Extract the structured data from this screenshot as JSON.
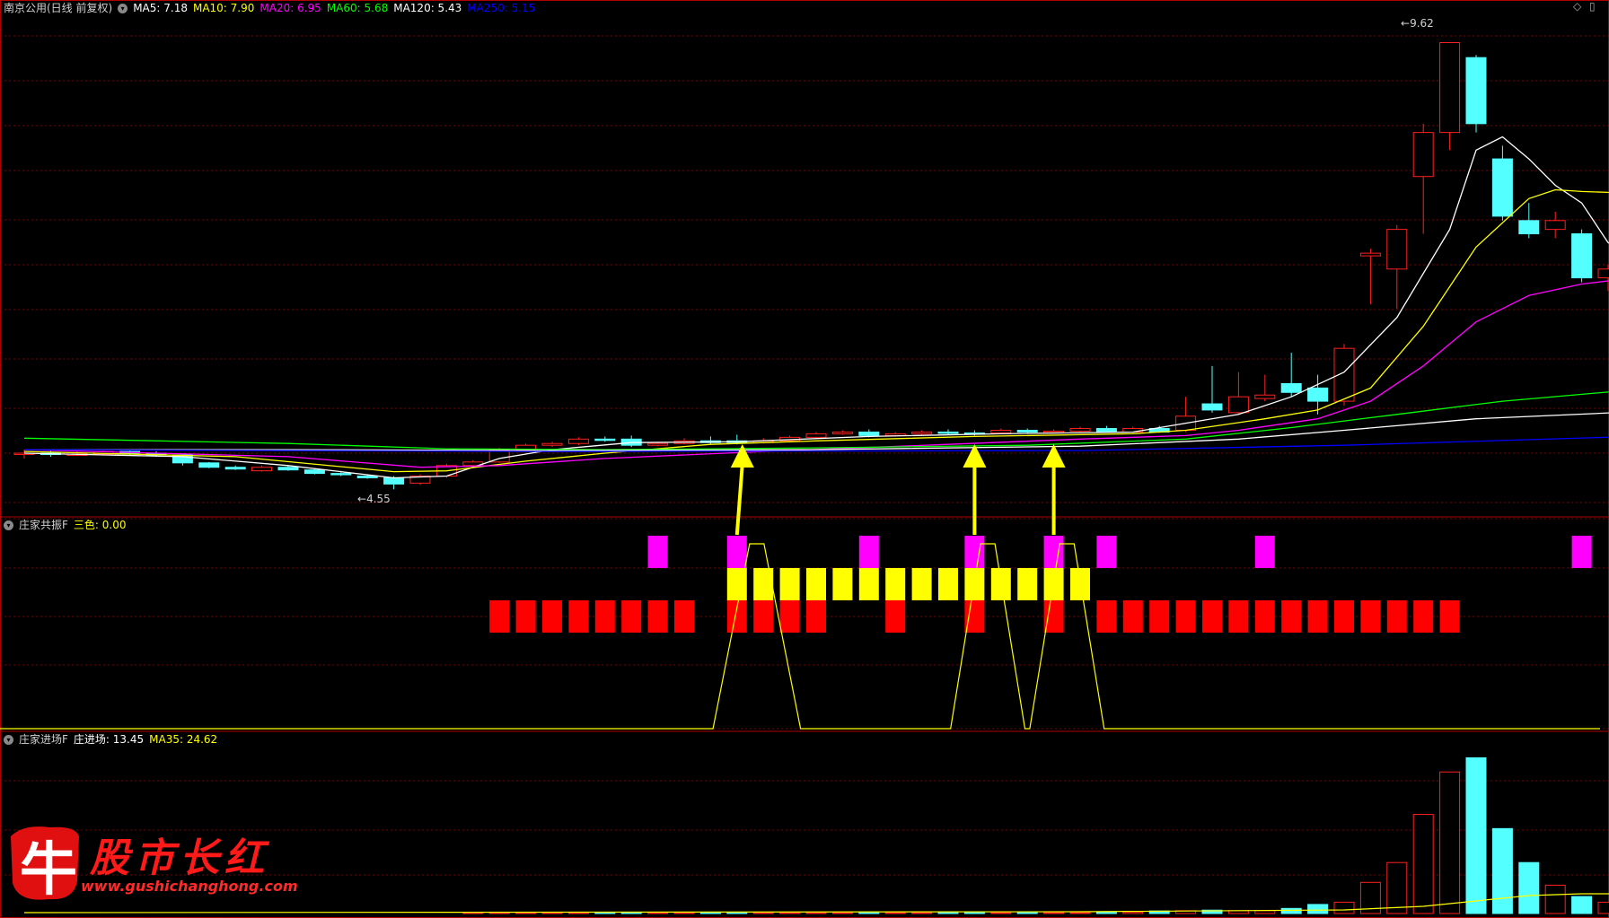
{
  "header": {
    "title": "南京公用(日线 前复权)",
    "ma_items": [
      {
        "text": "MA5: 7.18",
        "color": "#ffffff"
      },
      {
        "text": "MA10: 7.90",
        "color": "#ffff00"
      },
      {
        "text": "MA20: 6.95",
        "color": "#ff00ff"
      },
      {
        "text": "MA60: 5.68",
        "color": "#00ff00"
      },
      {
        "text": "MA120: 5.43",
        "color": "#ffffff"
      },
      {
        "text": "MA250: 5.15",
        "color": "#0000ff"
      }
    ]
  },
  "panel2": {
    "name": "庄家共振F",
    "items": [
      {
        "text": "三色: 0.00",
        "color": "#ffff00"
      }
    ]
  },
  "panel3": {
    "name": "庄家进场F",
    "items": [
      {
        "text": "庄进场: 13.45",
        "color": "#ffffff"
      },
      {
        "text": "MA35: 24.62",
        "color": "#ffff00"
      }
    ]
  },
  "annotations": {
    "high": "9.62",
    "low": "4.55"
  },
  "logo": {
    "glyph": "牛",
    "name": "股市长红",
    "url": "www.gushichanghong.com"
  },
  "colors": {
    "up": "#ff2020",
    "down": "#54ffff",
    "grid": "#7a0000",
    "signal_magenta": "#ff00ff",
    "signal_yellow": "#ffff00",
    "signal_red": "#ff0000",
    "arrow": "#ffff00"
  },
  "chart_data": {
    "type": "candlestick",
    "price_range": [
      4.4,
      9.9
    ],
    "candles": [
      [
        4.95,
        4.96,
        5.0,
        4.9
      ],
      [
        4.96,
        4.95,
        4.99,
        4.92
      ],
      [
        4.95,
        4.95,
        4.98,
        4.93
      ],
      [
        4.95,
        4.98,
        5.0,
        4.93
      ],
      [
        4.98,
        4.96,
        5.0,
        4.94
      ],
      [
        4.96,
        4.94,
        4.98,
        4.92
      ],
      [
        4.94,
        4.85,
        4.95,
        4.82
      ],
      [
        4.85,
        4.8,
        4.86,
        4.79
      ],
      [
        4.8,
        4.78,
        4.82,
        4.77
      ],
      [
        4.76,
        4.8,
        4.82,
        4.75
      ],
      [
        4.8,
        4.77,
        4.82,
        4.76
      ],
      [
        4.77,
        4.73,
        4.78,
        4.72
      ],
      [
        4.73,
        4.72,
        4.76,
        4.7
      ],
      [
        4.7,
        4.68,
        4.72,
        4.67
      ],
      [
        4.68,
        4.61,
        4.7,
        4.55
      ],
      [
        4.62,
        4.7,
        4.72,
        4.6
      ],
      [
        4.7,
        4.82,
        4.84,
        4.68
      ],
      [
        4.82,
        4.86,
        4.88,
        4.8
      ],
      [
        4.86,
        5.0,
        5.02,
        4.85
      ],
      [
        5.0,
        5.05,
        5.07,
        4.98
      ],
      [
        5.05,
        5.07,
        5.09,
        5.03
      ],
      [
        5.07,
        5.12,
        5.14,
        5.05
      ],
      [
        5.12,
        5.11,
        5.15,
        5.09
      ],
      [
        5.12,
        5.05,
        5.16,
        5.03
      ],
      [
        5.05,
        5.07,
        5.09,
        5.04
      ],
      [
        5.07,
        5.1,
        5.13,
        5.06
      ],
      [
        5.1,
        5.08,
        5.15,
        5.06
      ],
      [
        5.1,
        5.08,
        5.17,
        5.06
      ],
      [
        5.08,
        5.1,
        5.13,
        5.07
      ],
      [
        5.1,
        5.14,
        5.16,
        5.08
      ],
      [
        5.14,
        5.18,
        5.2,
        5.12
      ],
      [
        5.18,
        5.2,
        5.22,
        5.17
      ],
      [
        5.2,
        5.16,
        5.23,
        5.14
      ],
      [
        5.16,
        5.18,
        5.2,
        5.15
      ],
      [
        5.18,
        5.2,
        5.22,
        5.17
      ],
      [
        5.2,
        5.19,
        5.23,
        5.17
      ],
      [
        5.19,
        5.18,
        5.22,
        5.16
      ],
      [
        5.19,
        5.22,
        5.24,
        5.18
      ],
      [
        5.22,
        5.2,
        5.24,
        5.19
      ],
      [
        5.2,
        5.21,
        5.23,
        5.19
      ],
      [
        5.21,
        5.24,
        5.26,
        5.2
      ],
      [
        5.24,
        5.2,
        5.27,
        5.19
      ],
      [
        5.2,
        5.24,
        5.26,
        5.19
      ],
      [
        5.24,
        5.2,
        5.27,
        5.19
      ],
      [
        5.22,
        5.38,
        5.6,
        5.2
      ],
      [
        5.52,
        5.45,
        5.95,
        5.42
      ],
      [
        5.42,
        5.6,
        5.88,
        5.4
      ],
      [
        5.58,
        5.62,
        5.85,
        5.55
      ],
      [
        5.75,
        5.65,
        6.1,
        5.6
      ],
      [
        5.7,
        5.55,
        5.85,
        5.4
      ],
      [
        5.55,
        6.15,
        6.2,
        5.5
      ],
      [
        7.2,
        7.23,
        7.28,
        6.65
      ],
      [
        7.05,
        7.5,
        7.55,
        6.6
      ],
      [
        8.1,
        8.6,
        8.7,
        7.45
      ],
      [
        8.6,
        9.62,
        9.62,
        8.4
      ],
      [
        9.45,
        8.7,
        9.48,
        8.6
      ],
      [
        8.3,
        7.65,
        8.45,
        7.6
      ],
      [
        7.6,
        7.45,
        7.8,
        7.4
      ],
      [
        7.5,
        7.6,
        7.7,
        7.4
      ],
      [
        7.45,
        6.95,
        7.5,
        6.9
      ],
      [
        6.95,
        7.05,
        7.1,
        6.8
      ],
      [
        6.98,
        7.3,
        7.42,
        6.95
      ]
    ],
    "ma": [
      {
        "name": "MA5",
        "color": "#ffffff",
        "points": [
          [
            0,
            4.96
          ],
          [
            6,
            4.92
          ],
          [
            10,
            4.82
          ],
          [
            14,
            4.68
          ],
          [
            16,
            4.7
          ],
          [
            18,
            4.9
          ],
          [
            20,
            5.0
          ],
          [
            23,
            5.08
          ],
          [
            27,
            5.09
          ],
          [
            32,
            5.15
          ],
          [
            37,
            5.18
          ],
          [
            42,
            5.2
          ],
          [
            44,
            5.3
          ],
          [
            46,
            5.4
          ],
          [
            48,
            5.6
          ],
          [
            50,
            5.88
          ],
          [
            52,
            6.5
          ],
          [
            54,
            7.5
          ],
          [
            55,
            8.4
          ],
          [
            56,
            8.55
          ],
          [
            57,
            8.3
          ],
          [
            58,
            8.0
          ],
          [
            59,
            7.8
          ],
          [
            60,
            7.35
          ],
          [
            61,
            7.2
          ]
        ]
      },
      {
        "name": "MA10",
        "color": "#ffff00",
        "points": [
          [
            0,
            4.98
          ],
          [
            8,
            4.92
          ],
          [
            14,
            4.75
          ],
          [
            16,
            4.76
          ],
          [
            19,
            4.87
          ],
          [
            22,
            4.96
          ],
          [
            26,
            5.06
          ],
          [
            30,
            5.1
          ],
          [
            36,
            5.15
          ],
          [
            42,
            5.18
          ],
          [
            44,
            5.22
          ],
          [
            47,
            5.35
          ],
          [
            49,
            5.45
          ],
          [
            51,
            5.7
          ],
          [
            53,
            6.4
          ],
          [
            55,
            7.3
          ],
          [
            57,
            7.85
          ],
          [
            58,
            7.95
          ],
          [
            59,
            7.93
          ],
          [
            60,
            7.92
          ],
          [
            61,
            7.9
          ]
        ]
      },
      {
        "name": "MA20",
        "color": "#ff00ff",
        "points": [
          [
            0,
            5.0
          ],
          [
            10,
            4.92
          ],
          [
            15,
            4.8
          ],
          [
            18,
            4.82
          ],
          [
            22,
            4.9
          ],
          [
            28,
            4.98
          ],
          [
            35,
            5.06
          ],
          [
            40,
            5.12
          ],
          [
            44,
            5.16
          ],
          [
            46,
            5.22
          ],
          [
            49,
            5.35
          ],
          [
            51,
            5.55
          ],
          [
            53,
            5.95
          ],
          [
            55,
            6.45
          ],
          [
            57,
            6.75
          ],
          [
            59,
            6.88
          ],
          [
            61,
            6.95
          ]
        ]
      },
      {
        "name": "MA60",
        "color": "#00ff00",
        "points": [
          [
            0,
            5.13
          ],
          [
            10,
            5.07
          ],
          [
            16,
            5.01
          ],
          [
            22,
            5.0
          ],
          [
            30,
            5.02
          ],
          [
            38,
            5.05
          ],
          [
            44,
            5.12
          ],
          [
            48,
            5.25
          ],
          [
            52,
            5.4
          ],
          [
            56,
            5.55
          ],
          [
            61,
            5.68
          ]
        ]
      },
      {
        "name": "MA120",
        "color": "#ffffff",
        "points": [
          [
            0,
            5.0
          ],
          [
            10,
            5.0
          ],
          [
            20,
            4.99
          ],
          [
            30,
            5.0
          ],
          [
            40,
            5.04
          ],
          [
            46,
            5.12
          ],
          [
            50,
            5.22
          ],
          [
            55,
            5.35
          ],
          [
            61,
            5.43
          ]
        ]
      },
      {
        "name": "MA250",
        "color": "#0000ff",
        "points": [
          [
            0,
            5.0
          ],
          [
            20,
            4.98
          ],
          [
            40,
            4.99
          ],
          [
            50,
            5.05
          ],
          [
            61,
            5.15
          ]
        ]
      }
    ],
    "arrows": [
      27,
      36,
      39
    ],
    "panel2_signals": {
      "magenta": [
        24,
        27,
        32,
        36,
        39,
        41,
        47,
        59
      ],
      "yellow_range": [
        27,
        40
      ],
      "red": [
        18,
        19,
        20,
        21,
        22,
        23,
        24,
        25,
        27,
        28,
        29,
        30,
        33,
        36,
        39,
        41,
        42,
        43,
        44,
        45,
        46,
        47,
        48,
        49,
        50,
        51,
        52,
        53,
        54
      ],
      "yellow_line_peaks": [
        [
          26.5,
          29
        ],
        [
          35.5,
          37.5
        ],
        [
          38.5,
          40.5
        ]
      ],
      "three_color_value": 0.0
    },
    "volume": [
      0,
      0,
      0,
      0,
      0,
      0,
      0,
      0,
      0,
      0,
      0,
      0,
      0,
      0,
      0,
      0,
      0,
      0.2,
      0.2,
      0.2,
      0.3,
      0.2,
      0.2,
      0.2,
      0.2,
      0.3,
      0.3,
      0.3,
      0.3,
      0.3,
      0.3,
      0.3,
      0.3,
      0.3,
      0.3,
      0.3,
      0.3,
      0.3,
      0.3,
      0.3,
      0.3,
      0.4,
      0.5,
      0.9,
      1.0,
      1.2,
      1.0,
      1.0,
      1.8,
      3.2,
      4.0,
      11,
      18,
      35,
      50,
      55,
      30,
      18,
      10,
      6,
      4,
      3
    ],
    "volume_max": 58
  }
}
